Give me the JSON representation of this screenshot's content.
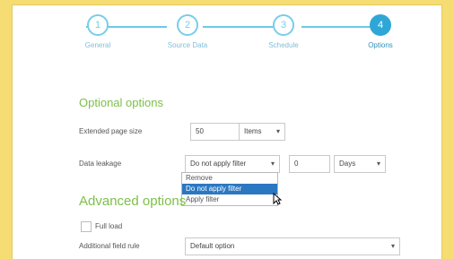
{
  "stepper": {
    "steps": [
      {
        "number": "1",
        "label": "General"
      },
      {
        "number": "2",
        "label": "Source Data"
      },
      {
        "number": "3",
        "label": "Schedule"
      },
      {
        "number": "4",
        "label": "Options"
      }
    ],
    "active_step": 4
  },
  "optional": {
    "title": "Optional options",
    "page_size_label": "Extended page size",
    "page_size_value": "50",
    "page_size_unit": "Items",
    "data_leakage_label": "Data leakage",
    "data_leakage_selected": "Do not apply filter",
    "data_leakage_number": "0",
    "data_leakage_unit": "Days",
    "dropdown_options": [
      "Remove",
      "Do not apply filter",
      "Apply filter"
    ],
    "dropdown_selected_index": 1
  },
  "advanced": {
    "title": "Advanced options",
    "full_load_label": "Full load",
    "field_label": "Additional field rule",
    "field_value": "Default option"
  },
  "colors": {
    "background": "#f5dd74",
    "accent": "#2fa7d6",
    "section": "#7dbf49",
    "selected": "#2b78c2"
  }
}
